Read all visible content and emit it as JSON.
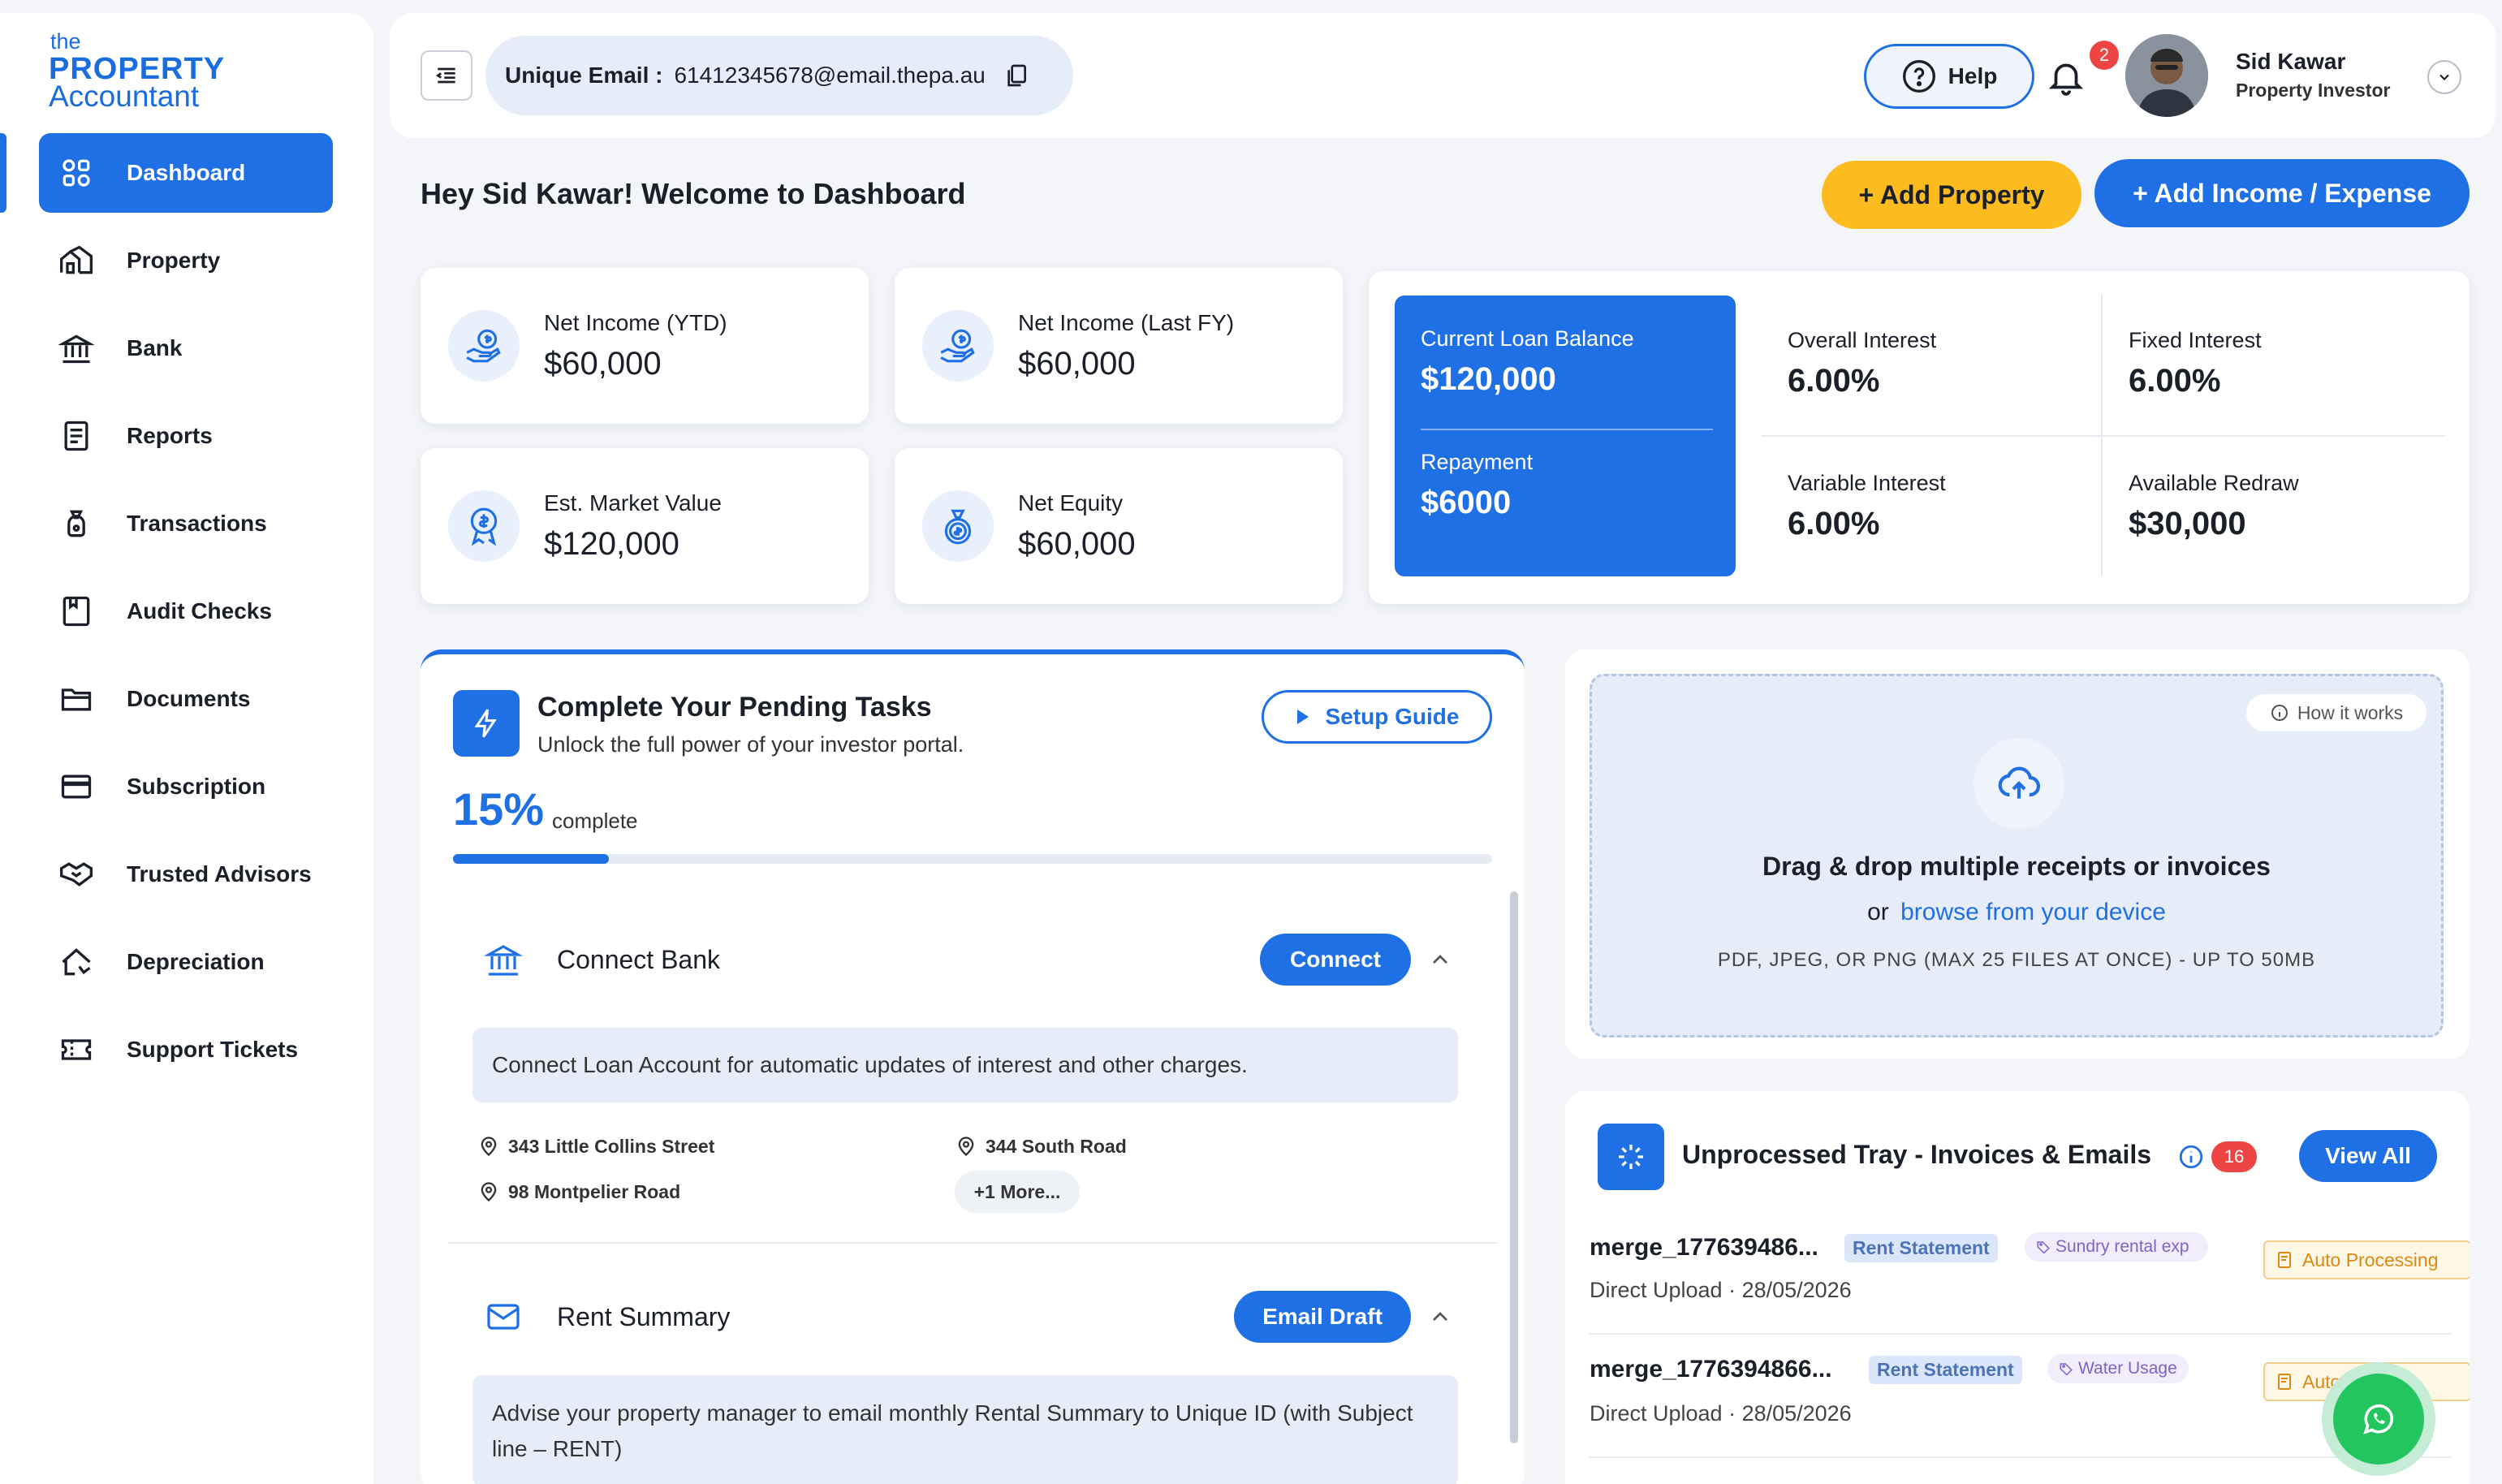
{
  "brand": {
    "line1": "the",
    "line2": "PROPERTY",
    "line3": "Accountant",
    "color": "#1a6de0"
  },
  "sidebar": {
    "items": [
      {
        "label": "Dashboard",
        "icon": "dashboard-grid-icon",
        "active": true
      },
      {
        "label": "Property",
        "icon": "property-house-icon"
      },
      {
        "label": "Bank",
        "icon": "bank-icon"
      },
      {
        "label": "Reports",
        "icon": "reports-icon"
      },
      {
        "label": "Transactions",
        "icon": "transactions-icon"
      },
      {
        "label": "Audit Checks",
        "icon": "audit-checks-icon"
      },
      {
        "label": "Documents",
        "icon": "documents-folder-icon"
      },
      {
        "label": "Subscription",
        "icon": "subscription-card-icon"
      },
      {
        "label": "Trusted Advisors",
        "icon": "handshake-icon"
      },
      {
        "label": "Depreciation",
        "icon": "depreciation-house-icon"
      },
      {
        "label": "Support Tickets",
        "icon": "support-ticket-icon"
      }
    ]
  },
  "header": {
    "email_label": "Unique Email :",
    "email_value": "61412345678@email.thepa.au",
    "help_label": "Help",
    "notif_count": "2",
    "user_name": "Sid Kawar",
    "user_role": "Property Investor"
  },
  "welcome": "Hey Sid Kawar! Welcome to Dashboard",
  "actions": {
    "add_property": "+ Add Property",
    "add_income": "+ Add Income / Expense"
  },
  "stats": [
    {
      "label": "Net Income (YTD)",
      "value": "$60,000",
      "icon": "money-hand-icon"
    },
    {
      "label": "Net Income (Last FY)",
      "value": "$60,000",
      "icon": "money-hand-icon"
    },
    {
      "label": "Est. Market Value",
      "value": "$120,000",
      "icon": "dollar-badge-icon"
    },
    {
      "label": "Net Equity",
      "value": "$60,000",
      "icon": "money-bag-icon"
    }
  ],
  "loan": {
    "balance_label": "Current Loan Balance",
    "balance_value": "$120,000",
    "repay_label": "Repayment",
    "repay_value": "$6000",
    "overall_label": "Overall Interest",
    "overall_value": "6.00%",
    "fixed_label": "Fixed Interest",
    "fixed_value": "6.00%",
    "variable_label": "Variable Interest",
    "variable_value": "6.00%",
    "redraw_label": "Available Redraw",
    "redraw_value": "$30,000"
  },
  "tasks": {
    "title": "Complete Your Pending Tasks",
    "subtitle": "Unlock the full power of your investor portal.",
    "setup_guide": "Setup Guide",
    "percent": "15%",
    "percent_value": 0.15,
    "complete_label": "complete",
    "bank": {
      "title": "Connect Bank",
      "button": "Connect",
      "info": "Connect Loan Account for automatic updates of interest and other charges.",
      "addresses": [
        "343 Little Collins Street",
        "344 South Road",
        "98 Montpelier Road"
      ],
      "more": "+1 More..."
    },
    "rent": {
      "title": "Rent Summary",
      "button": "Email Draft",
      "info": "Advise your property manager to email monthly Rental Summary to Unique ID (with Subject line – RENT)"
    }
  },
  "upload": {
    "how_it_works": "How it works",
    "title": "Drag & drop multiple receipts or invoices",
    "or": "or",
    "browse": "browse from your device",
    "formats": "PDF, JPEG, OR PNG (MAX 25 FILES AT ONCE) - UP TO 50MB"
  },
  "tray": {
    "title": "Unprocessed Tray - Invoices & Emails",
    "count": "16",
    "view_all": "View All",
    "rows": [
      {
        "name": "merge_177639486...",
        "tag": "Rent Statement",
        "category": "Sundry rental exp",
        "source": "Direct Upload · 28/05/2026",
        "status": "Auto Processing"
      },
      {
        "name": "merge_1776394866...",
        "tag": "Rent Statement",
        "category": "Water Usage",
        "source": "Direct Upload · 28/05/2026",
        "status": "Auto Pro"
      }
    ]
  },
  "colors": {
    "primary": "#1f6fe5",
    "accent_yellow": "#fcbc1f",
    "badge_red": "#ef4444",
    "whatsapp": "#22c55e"
  }
}
